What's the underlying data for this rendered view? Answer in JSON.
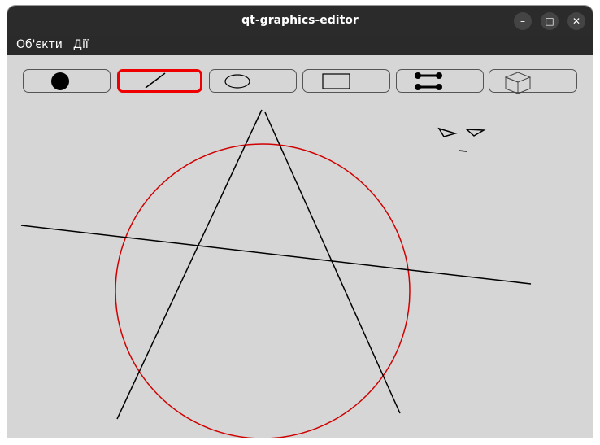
{
  "window": {
    "title": "qt-graphics-editor"
  },
  "menu": {
    "objects": "Об'єкти",
    "actions": "Дії"
  },
  "window_controls": {
    "minimize": "–",
    "maximize": "□",
    "close": "✕"
  },
  "toolbar": {
    "selected_tool": "line",
    "tools": [
      "point",
      "line",
      "ellipse",
      "rectangle",
      "line-with-circles",
      "cube"
    ]
  },
  "colors": {
    "selection": "#ee0000",
    "circle_stroke": "#d00000",
    "line_stroke": "#000000"
  }
}
